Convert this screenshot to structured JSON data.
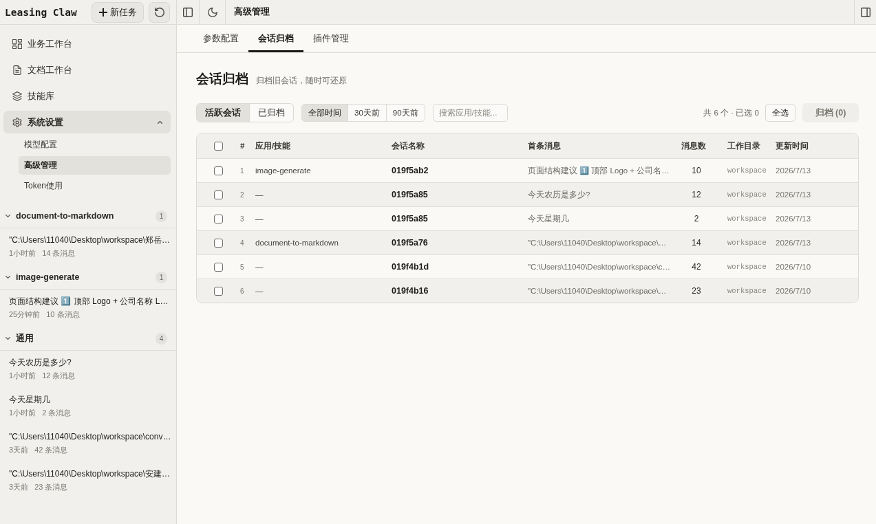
{
  "sidebar": {
    "logo": "Leasing Claw",
    "new_task_button": "新任务",
    "nav": [
      {
        "label": "业务工作台",
        "selected": false
      },
      {
        "label": "文档工作台",
        "selected": false
      },
      {
        "label": "技能库",
        "selected": false
      },
      {
        "label": "系统设置",
        "selected": true,
        "expanded": true,
        "children": [
          {
            "label": "模型配置",
            "selected": false
          },
          {
            "label": "高级管理",
            "selected": true
          },
          {
            "label": "Token使用",
            "selected": false
          }
        ]
      }
    ],
    "session_groups": [
      {
        "name": "document-to-markdown",
        "count": "1",
        "expanded": true,
        "items": [
          {
            "title": "\"C:\\Users\\11040\\Desktop\\workspace\\郑岳…",
            "time": "1小时前",
            "messages": "14 条消息"
          }
        ]
      },
      {
        "name": "image-generate",
        "count": "1",
        "expanded": true,
        "items": [
          {
            "title": "页面结构建议 1️⃣ 顶部 Logo + 公司名称 L…",
            "time": "25分钟前",
            "messages": "10 条消息"
          }
        ]
      },
      {
        "name": "通用",
        "count": "4",
        "expanded": true,
        "items": [
          {
            "title": "今天农历是多少?",
            "time": "1小时前",
            "messages": "12 条消息"
          },
          {
            "title": "今天星期几",
            "time": "1小时前",
            "messages": "2 条消息"
          },
          {
            "title": "\"C:\\Users\\11040\\Desktop\\workspace\\conv…",
            "time": "3天前",
            "messages": "42 条消息"
          },
          {
            "title": "\"C:\\Users\\11040\\Desktop\\workspace\\安建…",
            "time": "3天前",
            "messages": "23 条消息"
          }
        ]
      }
    ]
  },
  "topbar": {
    "title": "高级管理"
  },
  "tabs": [
    {
      "label": "参数配置",
      "selected": false
    },
    {
      "label": "会话归档",
      "selected": true
    },
    {
      "label": "插件管理",
      "selected": false
    }
  ],
  "page": {
    "heading": "会话归档",
    "subtitle": "归档旧会话，随时可还原"
  },
  "filters": {
    "status": [
      {
        "label": "活跃会话",
        "selected": true
      },
      {
        "label": "已归档",
        "selected": false
      }
    ],
    "time": [
      {
        "label": "全部时间",
        "selected": true
      },
      {
        "label": "30天前",
        "selected": false
      },
      {
        "label": "90天前",
        "selected": false
      }
    ],
    "search": {
      "placeholder": "搜索应用/技能..."
    },
    "summary": "共 6 个 · 已选 0",
    "select_all_button": "全选",
    "archive_button": {
      "label": "归档 (0)",
      "disabled": true
    }
  },
  "table": {
    "header_checked": false,
    "columns": [
      "#",
      "应用/技能",
      "会话名称",
      "首条消息",
      "消息数",
      "工作目录",
      "更新时间"
    ],
    "rows": [
      {
        "checked": false,
        "index": "1",
        "app": "image-generate",
        "name": "019f5ab2",
        "first_message": "页面结构建议 1️⃣ 顶部 Logo + 公司名…",
        "messages": "10",
        "workdir": "workspace",
        "updated": "2026/7/13"
      },
      {
        "checked": false,
        "index": "2",
        "app": "—",
        "name": "019f5a85",
        "first_message": "今天农历是多少?",
        "messages": "12",
        "workdir": "workspace",
        "updated": "2026/7/13"
      },
      {
        "checked": false,
        "index": "3",
        "app": "—",
        "name": "019f5a85",
        "first_message": "今天星期几",
        "messages": "2",
        "workdir": "workspace",
        "updated": "2026/7/13"
      },
      {
        "checked": false,
        "index": "4",
        "app": "document-to-markdown",
        "name": "019f5a76",
        "first_message": "\"C:\\Users\\11040\\Desktop\\workspace\\…",
        "messages": "14",
        "workdir": "workspace",
        "updated": "2026/7/13"
      },
      {
        "checked": false,
        "index": "5",
        "app": "—",
        "name": "019f4b1d",
        "first_message": "\"C:\\Users\\11040\\Desktop\\workspace\\c…",
        "messages": "42",
        "workdir": "workspace",
        "updated": "2026/7/10"
      },
      {
        "checked": false,
        "index": "6",
        "app": "—",
        "name": "019f4b16",
        "first_message": "\"C:\\Users\\11040\\Desktop\\workspace\\…",
        "messages": "23",
        "workdir": "workspace",
        "updated": "2026/7/10"
      }
    ]
  }
}
